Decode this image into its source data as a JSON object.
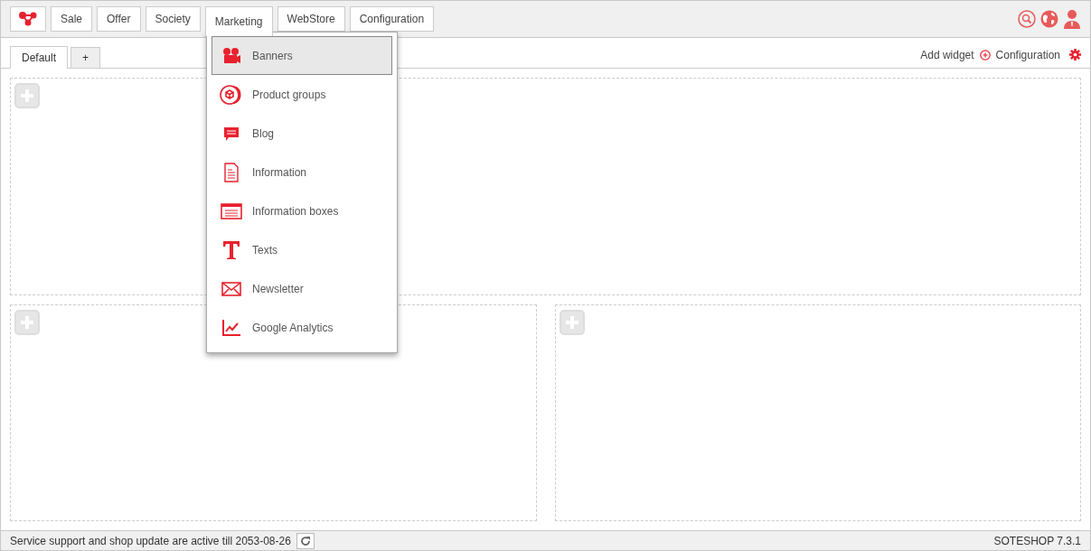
{
  "nav": [
    {
      "label": "Sale",
      "selected": false
    },
    {
      "label": "Offer",
      "selected": false
    },
    {
      "label": "Society",
      "selected": false
    },
    {
      "label": "Marketing",
      "selected": true
    },
    {
      "label": "WebStore",
      "selected": false
    },
    {
      "label": "Configuration",
      "selected": false
    }
  ],
  "menu": [
    {
      "label": "Banners",
      "kind": "camera",
      "selected": true
    },
    {
      "label": "Product groups",
      "kind": "cube",
      "selected": false
    },
    {
      "label": "Blog",
      "kind": "chat",
      "selected": false
    },
    {
      "label": "Information",
      "kind": "document",
      "selected": false
    },
    {
      "label": "Information boxes",
      "kind": "box",
      "selected": false
    },
    {
      "label": "Texts",
      "kind": "text",
      "selected": false
    },
    {
      "label": "Newsletter",
      "kind": "mail",
      "selected": false
    },
    {
      "label": "Google Analytics",
      "kind": "chart",
      "selected": false
    }
  ],
  "tabs": [
    {
      "label": "Default",
      "selected": true
    },
    {
      "label": "+",
      "selected": false
    }
  ],
  "toolbar": {
    "add_widget": "Add widget",
    "configuration": "Configuration"
  },
  "panels": [
    {
      "kind": "wide"
    },
    {
      "kind": "half"
    },
    {
      "kind": "half"
    }
  ],
  "status_bar": {
    "message": "Service support and shop update are active till 2053-08-26",
    "version": "SOTESHOP 7.3.1"
  }
}
